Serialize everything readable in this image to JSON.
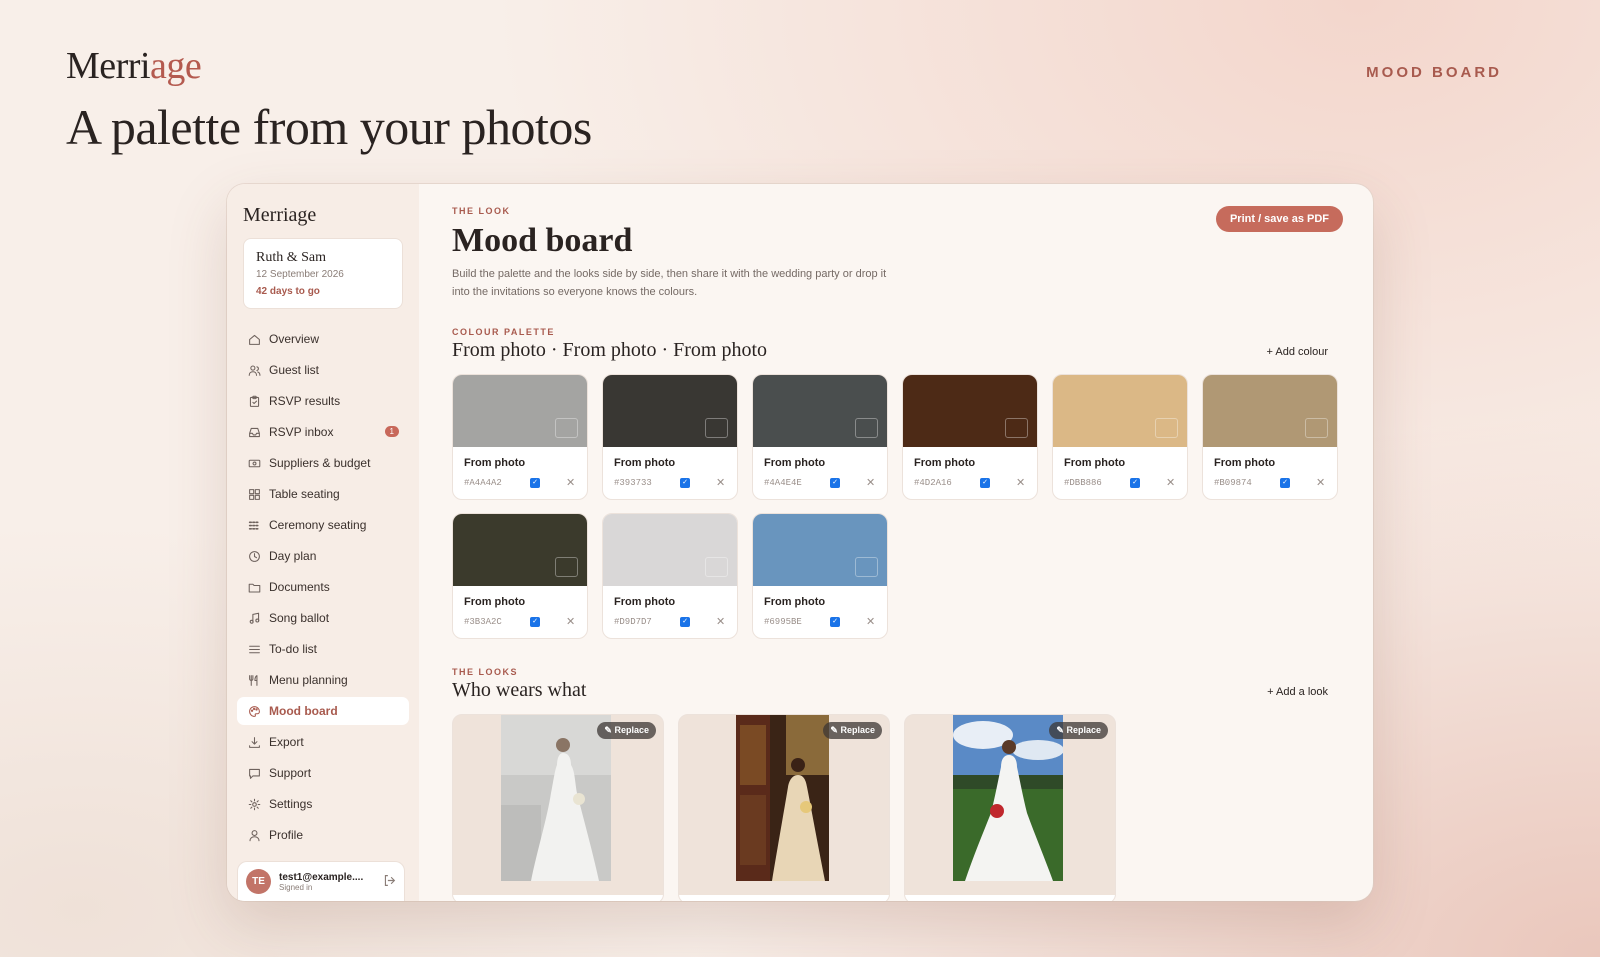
{
  "brand": {
    "main": "Merri",
    "accent": "age"
  },
  "hero_title": "A palette from your photos",
  "top_tag": "MOOD BOARD",
  "sidebar": {
    "brand": "Merriage",
    "couple": {
      "name": "Ruth & Sam",
      "date": "12 September 2026",
      "days": "42 days to go"
    },
    "items": [
      {
        "label": "Overview",
        "icon": "home-icon"
      },
      {
        "label": "Guest list",
        "icon": "users-icon"
      },
      {
        "label": "RSVP results",
        "icon": "clipboard-icon"
      },
      {
        "label": "RSVP inbox",
        "icon": "inbox-icon",
        "badge": "1"
      },
      {
        "label": "Suppliers & budget",
        "icon": "money-icon"
      },
      {
        "label": "Table seating",
        "icon": "grid-icon"
      },
      {
        "label": "Ceremony seating",
        "icon": "seats-icon"
      },
      {
        "label": "Day plan",
        "icon": "clock-icon"
      },
      {
        "label": "Documents",
        "icon": "folder-icon"
      },
      {
        "label": "Song ballot",
        "icon": "music-icon"
      },
      {
        "label": "To-do list",
        "icon": "list-icon"
      },
      {
        "label": "Menu planning",
        "icon": "utensils-icon"
      },
      {
        "label": "Mood board",
        "icon": "palette-icon",
        "active": true
      },
      {
        "label": "Export",
        "icon": "download-icon"
      },
      {
        "label": "Support",
        "icon": "chat-icon"
      },
      {
        "label": "Settings",
        "icon": "gear-icon"
      },
      {
        "label": "Profile",
        "icon": "person-icon"
      }
    ],
    "user": {
      "initials": "TE",
      "email": "test1@example....",
      "status": "Signed in"
    }
  },
  "main": {
    "eyebrow": "THE LOOK",
    "title": "Mood board",
    "description": "Build the palette and the looks side by side, then share it with the wedding party or drop it into the invitations so everyone knows the colours.",
    "print_button": "Print / save as PDF",
    "palette": {
      "eyebrow": "COLOUR PALETTE",
      "title": "From photo · From photo · From photo",
      "add_label": "+ Add colour",
      "swatches": [
        {
          "name": "From photo",
          "hex": "#A4A4A2"
        },
        {
          "name": "From photo",
          "hex": "#393733"
        },
        {
          "name": "From photo",
          "hex": "#4A4E4E"
        },
        {
          "name": "From photo",
          "hex": "#4D2A16"
        },
        {
          "name": "From photo",
          "hex": "#DBB886"
        },
        {
          "name": "From photo",
          "hex": "#B09874"
        },
        {
          "name": "From photo",
          "hex": "#3B3A2C"
        },
        {
          "name": "From photo",
          "hex": "#D9D7D7"
        },
        {
          "name": "From photo",
          "hex": "#6995BE"
        }
      ]
    },
    "looks": {
      "eyebrow": "THE LOOKS",
      "title": "Who wears what",
      "add_label": "+ Add a look",
      "replace_label": "Replace",
      "items": [
        {
          "photo": "bride-photo-1"
        },
        {
          "photo": "bride-photo-2"
        },
        {
          "photo": "bride-photo-3"
        }
      ]
    }
  }
}
